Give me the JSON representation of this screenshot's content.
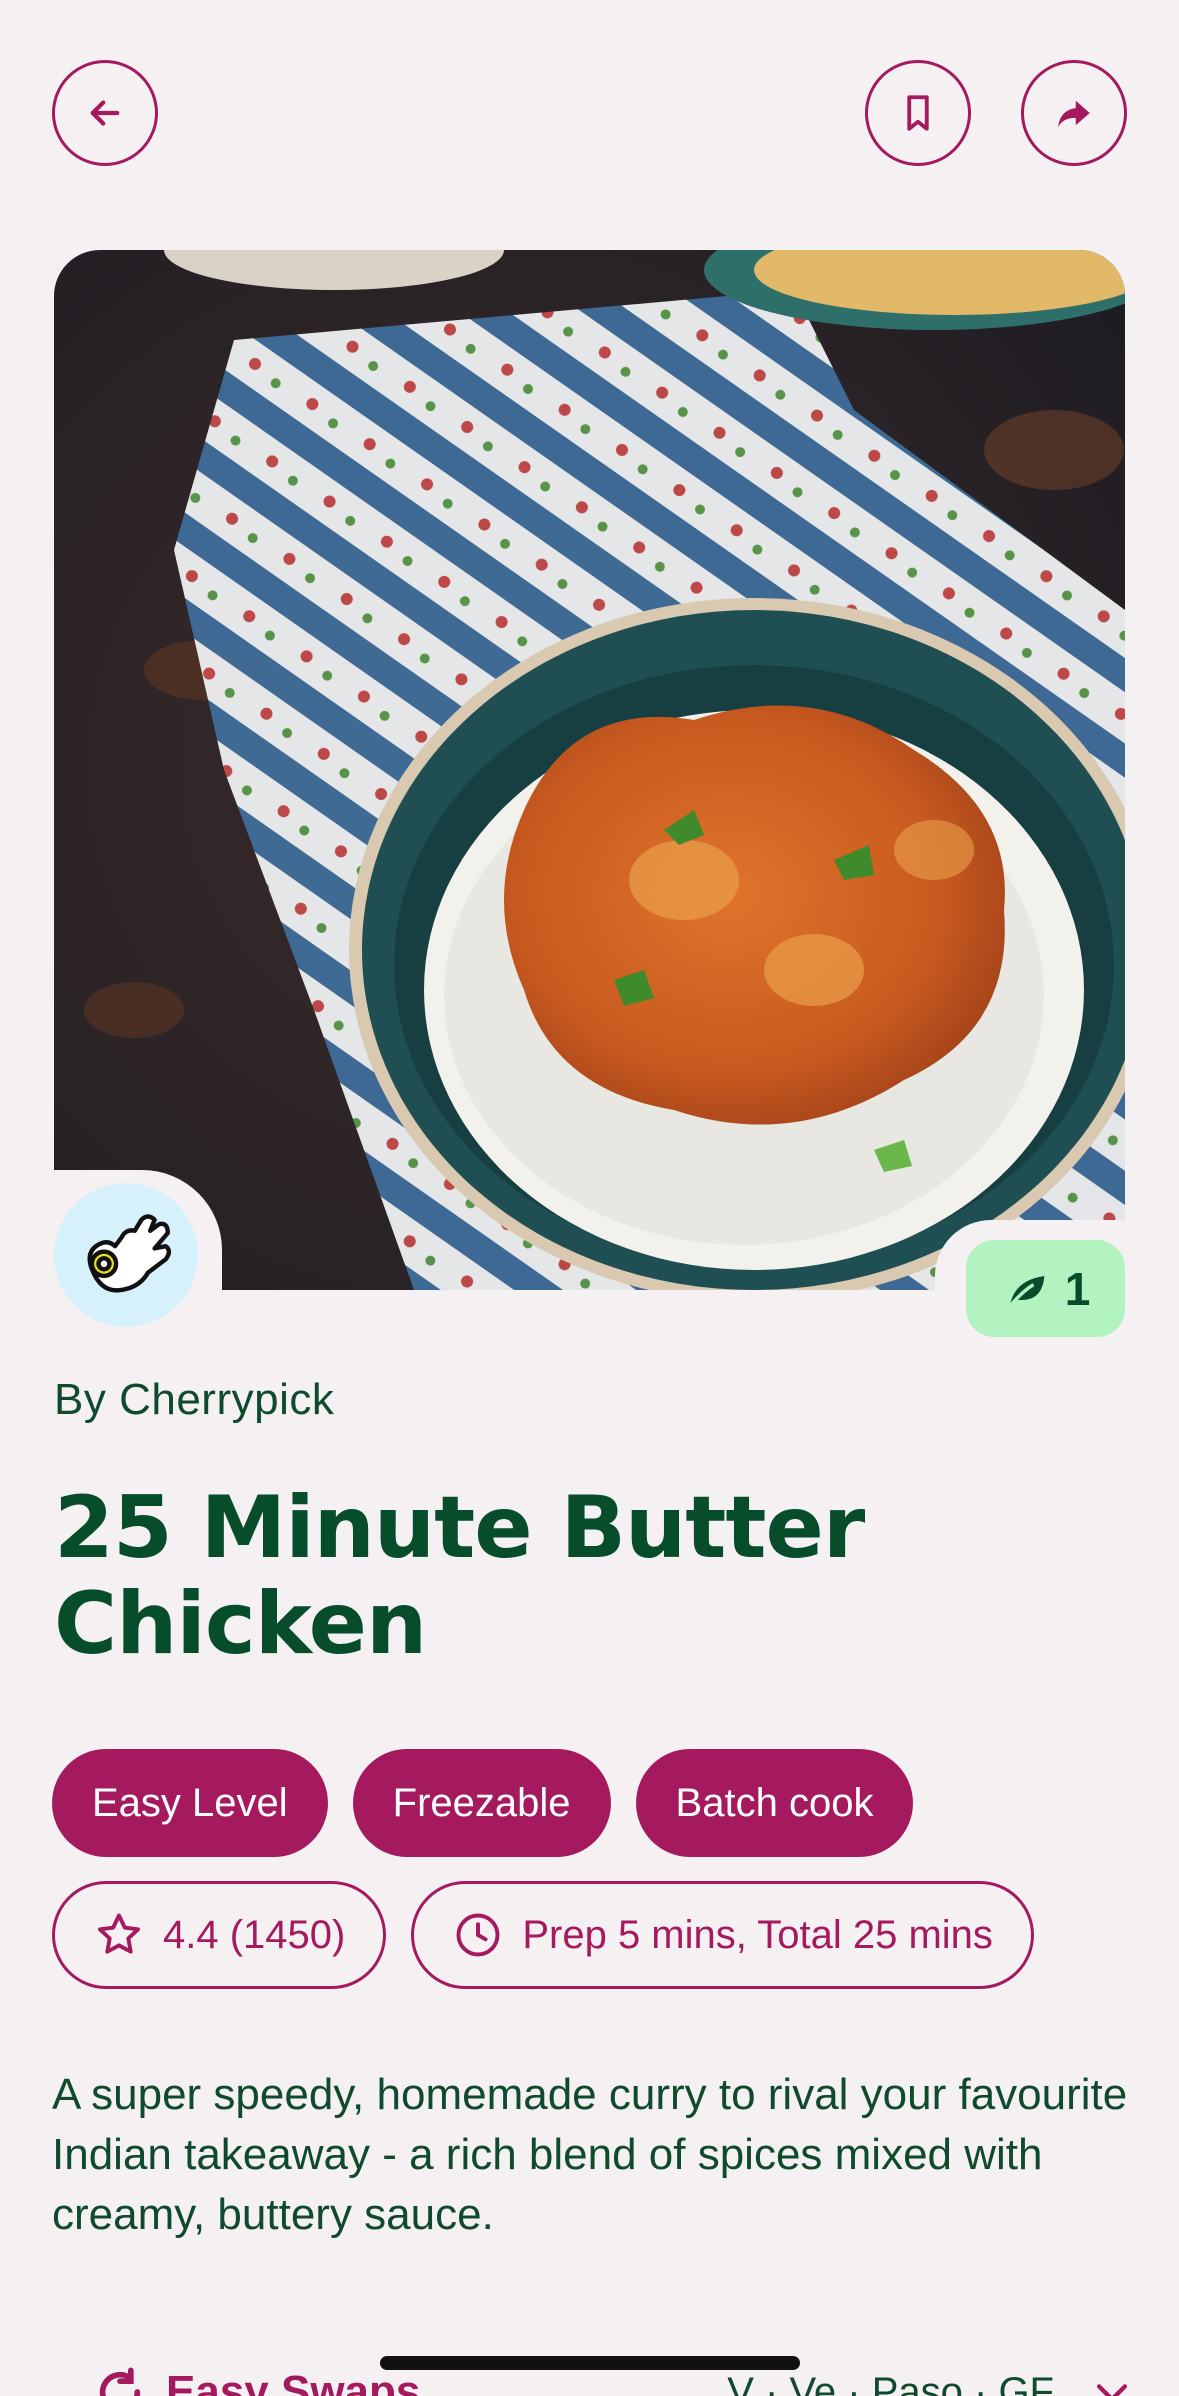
{
  "header": {
    "back_icon": "arrow-left-icon",
    "bookmark_icon": "bookmark-icon",
    "share_icon": "share-arrow-icon"
  },
  "hero": {
    "image": "butter-chicken-with-rice-photo",
    "avatar_icon": "ok-hand-logo-icon"
  },
  "eco_badge": {
    "icon": "leaf-icon",
    "value": "1"
  },
  "recipe": {
    "author": "By Cherrypick",
    "title": "25 Minute Butter Chicken",
    "tags": [
      "Easy Level",
      "Freezable",
      "Batch cook"
    ],
    "rating": "4.4 (1450)",
    "time": "Prep 5 mins, Total 25 mins",
    "description": "A super speedy, homemade curry to rival your favourite Indian takeaway - a rich blend of spices mixed with creamy, buttery sauce."
  },
  "swaps": {
    "label": "Easy Swaps",
    "diet": "V · Ve · Paso · GF"
  },
  "colors": {
    "accent": "#a5195e",
    "title_green": "#074d2c",
    "badge_green": "#b3f2c1",
    "background": "#f5f1f3"
  }
}
